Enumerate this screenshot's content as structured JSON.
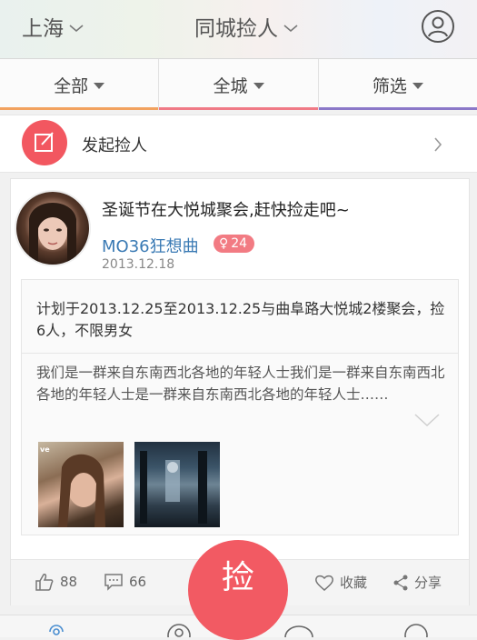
{
  "header": {
    "city": "上海",
    "title": "同城捡人",
    "profile_icon": "user-circle-icon"
  },
  "filters": [
    {
      "label": "全部",
      "underline_color": "#f2a25f"
    },
    {
      "label": "全城",
      "underline_color": "#f07a86"
    },
    {
      "label": "筛选",
      "underline_color": "#8b78c8"
    }
  ],
  "launch": {
    "label": "发起捡人",
    "icon": "edit-icon"
  },
  "post": {
    "title": "圣诞节在大悦城聚会,赶快捡走吧~",
    "author": "MO36狂想曲",
    "gender_symbol": "♀",
    "age": "24",
    "date": "2013.12.18",
    "plan": "计划于2013.12.25至2013.12.25与曲阜路大悦城2楼聚会，捡6人，不限男女",
    "description": "我们是一群来自东南西北各地的年轻人士我们是一群来自东南西北各地的年轻人士是一群来自东南西北各地的年轻人士……",
    "thumb1_label": "ve"
  },
  "footer": {
    "likes": "88",
    "comments": "66",
    "pick_label": "捡",
    "favorite_label": "收藏",
    "share_label": "分享"
  },
  "colors": {
    "accent": "#f25a63",
    "link": "#3a7ab4"
  }
}
